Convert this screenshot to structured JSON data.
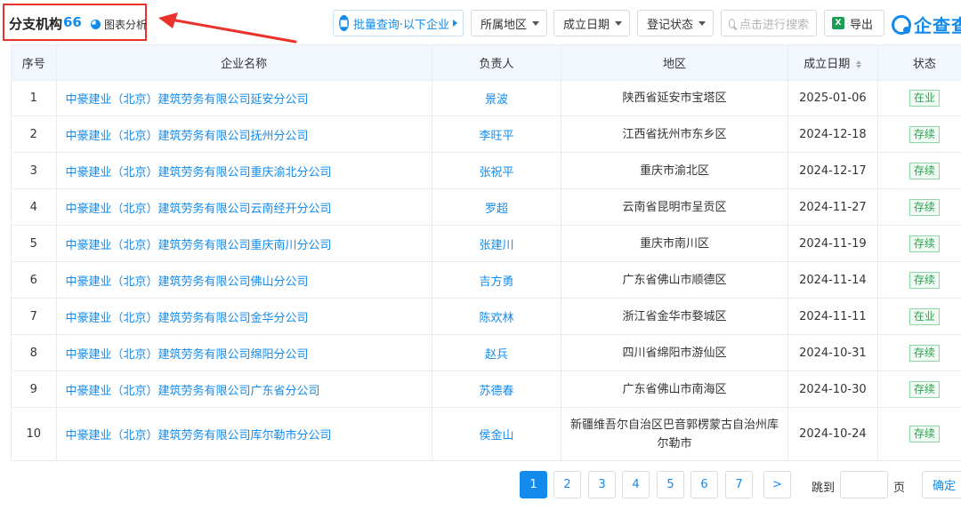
{
  "header": {
    "title": "分支机构",
    "count": "66",
    "chart_link": "图表分析",
    "batch_query": "批量查询·以下企业",
    "filters": {
      "region": "所属地区",
      "date": "成立日期",
      "status": "登记状态"
    },
    "search_placeholder": "点击进行搜索",
    "export_label": "导出",
    "export_icon_text": "X",
    "logo_text": "企查查",
    "accent_color": "#128bed",
    "highlight_color": "#e8322b"
  },
  "table": {
    "columns": [
      "序号",
      "企业名称",
      "负责人",
      "地区",
      "成立日期",
      "状态"
    ],
    "rows": [
      {
        "index": "1",
        "name": "中豪建业（北京）建筑劳务有限公司延安分公司",
        "person": "景波",
        "region": "陕西省延安市宝塔区",
        "date": "2025-01-06",
        "status": "在业"
      },
      {
        "index": "2",
        "name": "中豪建业（北京）建筑劳务有限公司抚州分公司",
        "person": "李旺平",
        "region": "江西省抚州市东乡区",
        "date": "2024-12-18",
        "status": "存续"
      },
      {
        "index": "3",
        "name": "中豪建业（北京）建筑劳务有限公司重庆渝北分公司",
        "person": "张祝平",
        "region": "重庆市渝北区",
        "date": "2024-12-17",
        "status": "存续"
      },
      {
        "index": "4",
        "name": "中豪建业（北京）建筑劳务有限公司云南经开分公司",
        "person": "罗超",
        "region": "云南省昆明市呈贡区",
        "date": "2024-11-27",
        "status": "存续"
      },
      {
        "index": "5",
        "name": "中豪建业（北京）建筑劳务有限公司重庆南川分公司",
        "person": "张建川",
        "region": "重庆市南川区",
        "date": "2024-11-19",
        "status": "存续"
      },
      {
        "index": "6",
        "name": "中豪建业（北京）建筑劳务有限公司佛山分公司",
        "person": "吉方勇",
        "region": "广东省佛山市顺德区",
        "date": "2024-11-14",
        "status": "存续"
      },
      {
        "index": "7",
        "name": "中豪建业（北京）建筑劳务有限公司金华分公司",
        "person": "陈欢林",
        "region": "浙江省金华市婺城区",
        "date": "2024-11-11",
        "status": "在业"
      },
      {
        "index": "8",
        "name": "中豪建业（北京）建筑劳务有限公司绵阳分公司",
        "person": "赵兵",
        "region": "四川省绵阳市游仙区",
        "date": "2024-10-31",
        "status": "存续"
      },
      {
        "index": "9",
        "name": "中豪建业（北京）建筑劳务有限公司广东省分公司",
        "person": "苏德春",
        "region": "广东省佛山市南海区",
        "date": "2024-10-30",
        "status": "存续"
      },
      {
        "index": "10",
        "name": "中豪建业（北京）建筑劳务有限公司库尔勒市分公司",
        "person": "侯金山",
        "region": "新疆维吾尔自治区巴音郭楞蒙古自治州库尔勒市",
        "date": "2024-10-24",
        "status": "存续"
      }
    ]
  },
  "pagination": {
    "pages": [
      "1",
      "2",
      "3",
      "4",
      "5",
      "6",
      "7"
    ],
    "current": "1",
    "next": ">",
    "jump_label": "跳到",
    "page_unit": "页",
    "confirm": "确定"
  }
}
